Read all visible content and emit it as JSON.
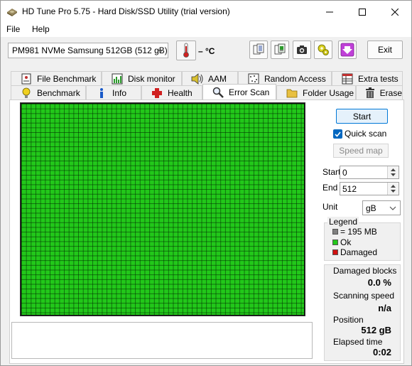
{
  "window": {
    "title": "HD Tune Pro 5.75 - Hard Disk/SSD Utility (trial version)"
  },
  "menu": {
    "file": "File",
    "help": "Help"
  },
  "toolbar": {
    "drive": "PM981 NVMe Samsung 512GB (512 gB)",
    "temperature": "– °C",
    "exit_label": "Exit"
  },
  "tabs": {
    "row1": [
      "File Benchmark",
      "Disk monitor",
      "AAM",
      "Random Access",
      "Extra tests"
    ],
    "row2": [
      "Benchmark",
      "Info",
      "Health",
      "Error Scan",
      "Folder Usage",
      "Erase"
    ],
    "active": "Error Scan"
  },
  "controls": {
    "start_label": "Start",
    "quick_scan_label": "Quick scan",
    "quick_scan_checked": true,
    "speed_map_label": "Speed map",
    "start_field_label": "Start",
    "start_value": "0",
    "end_field_label": "End",
    "end_value": "512",
    "unit_label": "Unit",
    "unit_value": "gB"
  },
  "legend": {
    "title": "Legend",
    "block_size": "= 195 MB",
    "ok": "Ok",
    "damaged": "Damaged",
    "colors": {
      "block": "#7f7f7f",
      "ok": "#22c81a",
      "damaged": "#d01010"
    }
  },
  "stats": {
    "damaged_blocks_label": "Damaged blocks",
    "damaged_blocks_value": "0.0 %",
    "scanning_speed_label": "Scanning speed",
    "scanning_speed_value": "n/a",
    "position_label": "Position",
    "position_value": "512 gB",
    "elapsed_time_label": "Elapsed time",
    "elapsed_time_value": "0:02"
  },
  "scan_map": {
    "status": "ok",
    "ok_fraction": 1.0,
    "color": "#22c81a"
  }
}
